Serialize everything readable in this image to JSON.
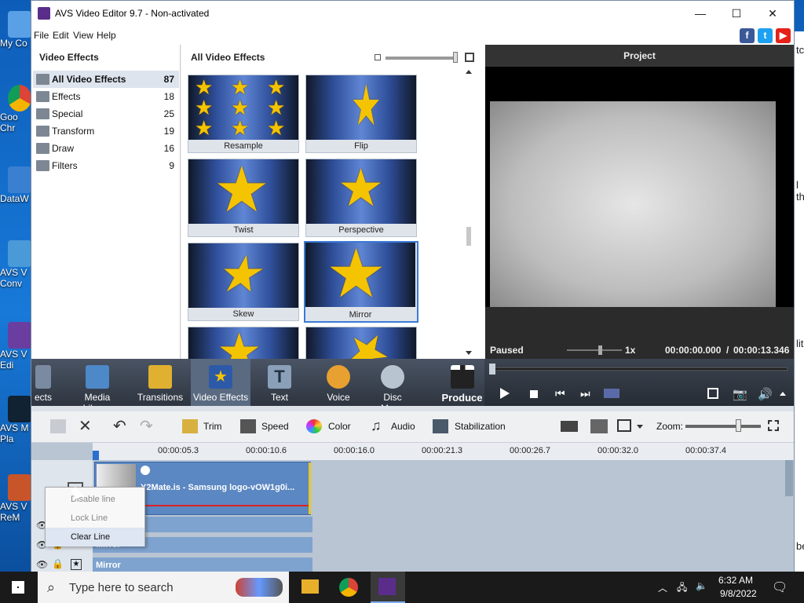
{
  "window": {
    "title": "AVS Video Editor 9.7 - Non-activated",
    "minimize": "—",
    "maximize": "☐",
    "close": "✕"
  },
  "menu": [
    "File",
    "Edit",
    "View",
    "Help"
  ],
  "social": {
    "facebook": "f",
    "twitter": "t",
    "youtube": "▶"
  },
  "left_panel": {
    "title": "Video Effects",
    "categories": [
      {
        "label": "All Video Effects",
        "count": "87"
      },
      {
        "label": "Effects",
        "count": "18"
      },
      {
        "label": "Special",
        "count": "25"
      },
      {
        "label": "Transform",
        "count": "19"
      },
      {
        "label": "Draw",
        "count": "16"
      },
      {
        "label": "Filters",
        "count": "9"
      }
    ]
  },
  "grid": {
    "title": "All Video Effects",
    "tiles": [
      "Resample",
      "Flip",
      "Twist",
      "Perspective",
      "Skew",
      "Mirror",
      "",
      ""
    ]
  },
  "project": {
    "title": "Project",
    "status": "Paused",
    "speed": "1x",
    "time": "00:00:00.000",
    "separator": "/",
    "duration": "00:00:13.346"
  },
  "toolbar": {
    "items": [
      "ects",
      "Media Library",
      "Transitions",
      "Video Effects",
      "Text",
      "Voice",
      "Disc Menu"
    ],
    "produce": "Produce"
  },
  "edit_tools": {
    "trim": "Trim",
    "speed": "Speed",
    "color": "Color",
    "audio": "Audio",
    "stabilization": "Stabilization",
    "zoom": "Zoom:"
  },
  "ruler": [
    "00:00:05.3",
    "00:00:10.6",
    "00:00:16.0",
    "00:00:21.3",
    "00:00:26.7",
    "00:00:32.0",
    "00:00:37.4"
  ],
  "clip": {
    "title": "Y2Mate.is - Samsung logo-vOW1g0i..."
  },
  "subtracks": [
    "Mirror",
    "Mirror",
    "Mirror"
  ],
  "context_menu": [
    "Disable line",
    "Lock Line",
    "Clear Line"
  ],
  "desktop_icons": [
    "My Co",
    "Goo Chr",
    "DataW",
    "AVS V Conv",
    "AVS V Edi",
    "AVS M Pla",
    "AVS V ReM"
  ],
  "right_strip": [
    "tc",
    "l th",
    "lit:",
    "be"
  ],
  "taskbar": {
    "search_placeholder": "Type here to search",
    "time": "6:32 AM",
    "date": "9/8/2022"
  }
}
